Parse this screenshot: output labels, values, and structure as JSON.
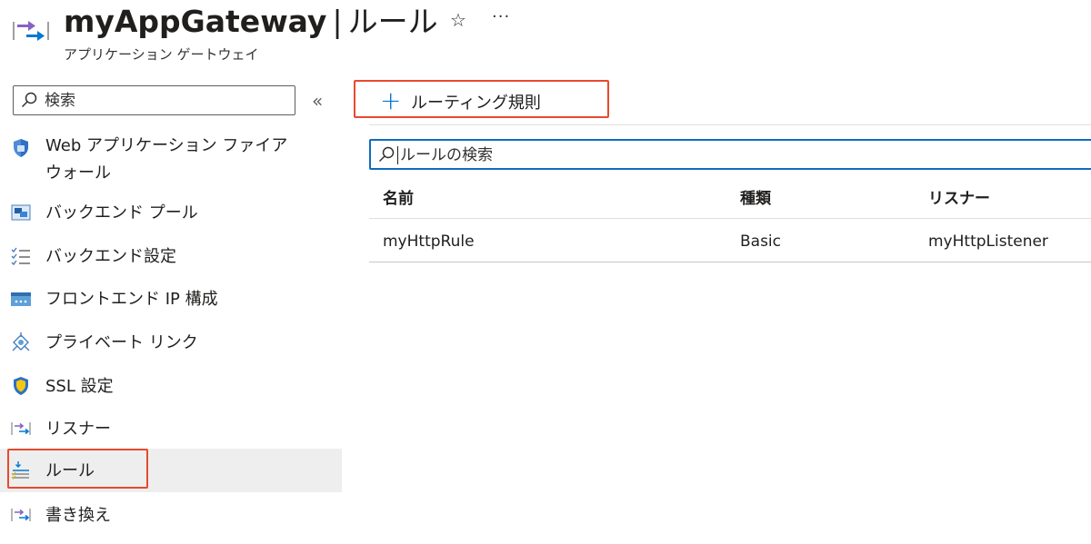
{
  "header": {
    "resource_name": "myAppGateway",
    "separator": "|",
    "blade_title": "ルール",
    "subtitle": "アプリケーション ゲートウェイ",
    "favorite_icon": "☆",
    "more_icon": "···"
  },
  "sidebar": {
    "search_placeholder": "検索",
    "collapse_icon": "«",
    "items": [
      {
        "label": "Web アプリケーション ファイア\nウォール",
        "icon": "waf-shield-icon"
      },
      {
        "label": "バックエンド プール",
        "icon": "backend-pool-icon"
      },
      {
        "label": "バックエンド設定",
        "icon": "backend-settings-icon"
      },
      {
        "label": "フロントエンド IP 構成",
        "icon": "frontend-ip-icon"
      },
      {
        "label": "プライベート リンク",
        "icon": "private-link-icon"
      },
      {
        "label": "SSL 設定",
        "icon": "ssl-shield-icon"
      },
      {
        "label": "リスナー",
        "icon": "listener-icon"
      },
      {
        "label": "ルール",
        "icon": "rules-icon",
        "active": true
      },
      {
        "label": "書き換え",
        "icon": "rewrite-icon"
      }
    ]
  },
  "toolbar": {
    "add_icon": "+",
    "add_label": "ルーティング規則"
  },
  "rules_search": {
    "placeholder": "ルールの検索"
  },
  "table": {
    "columns": [
      "名前",
      "種類",
      "リスナー"
    ],
    "rows": [
      [
        "myHttpRule",
        "Basic",
        "myHttpListener"
      ]
    ]
  },
  "colors": {
    "accent": "#0078d4",
    "highlight_box": "#e64a2e",
    "active_bg": "#eeeeee"
  }
}
